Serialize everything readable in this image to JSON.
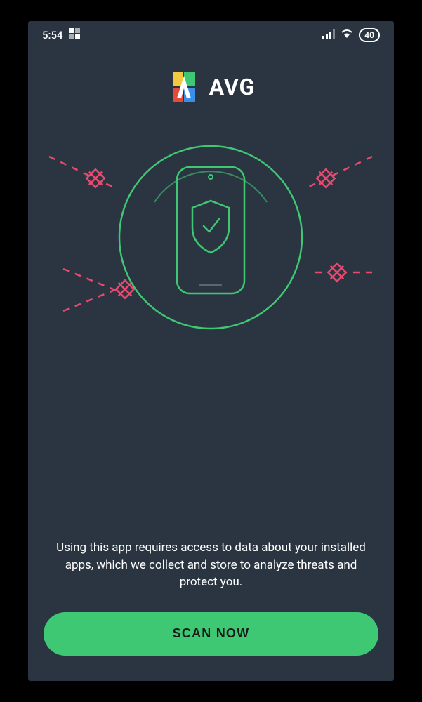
{
  "status_bar": {
    "time": "5:54",
    "battery_level": "40"
  },
  "logo": {
    "brand": "AVG"
  },
  "disclaimer_text": "Using this app requires access to data about your installed apps, which we collect and store to analyze threats and protect you.",
  "scan_button_label": "SCAN NOW",
  "colors": {
    "background": "#2a3541",
    "accent_green": "#3ec873",
    "threat_red": "#e84a6f"
  }
}
